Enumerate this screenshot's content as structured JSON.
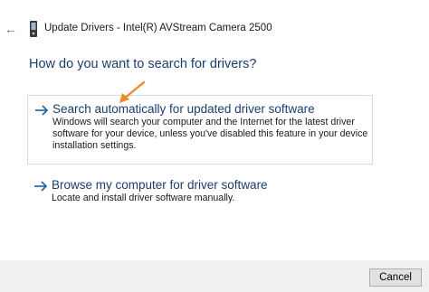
{
  "window": {
    "title": "Update Drivers - Intel(R) AVStream Camera 2500"
  },
  "main": {
    "question": "How do you want to search for drivers?",
    "options": [
      {
        "title": "Search automatically for updated driver software",
        "description": "Windows will search your computer and the Internet for the latest driver software for your device, unless you've disabled this feature in your device installation settings."
      },
      {
        "title": "Browse my computer for driver software",
        "description": "Locate and install driver software manually."
      }
    ]
  },
  "footer": {
    "cancel_label": "Cancel"
  },
  "colors": {
    "accent_text": "#1a3d78",
    "selection_border": "#c9dff2",
    "annotation_arrow": "#f08a24",
    "footer_bg": "#f0f0f0"
  },
  "icons": {
    "back": "back-arrow-icon",
    "device": "device-icon",
    "option_arrow": "right-arrow-icon",
    "annotation": "annotation-arrow-icon"
  }
}
